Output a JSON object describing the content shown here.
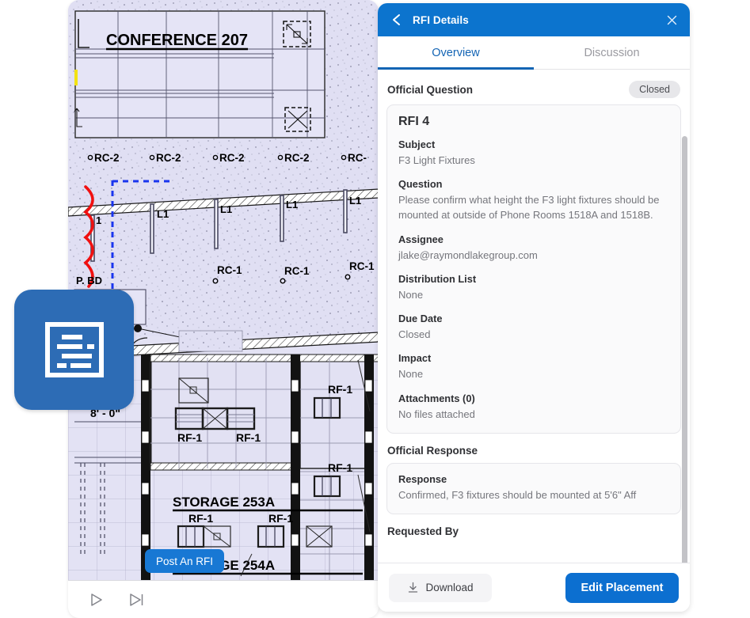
{
  "plan": {
    "labels": {
      "conference_room": "CONFERENCE  207",
      "storage_253a": "STORAGE  253A",
      "storage_254a": "STORAGE  254A",
      "dimension": "8' - 0\"",
      "partial_tag": "P. BD",
      "rc2": "RC-2",
      "rc1": "RC-1",
      "rc_partial": "RC-",
      "l1": "L1",
      "rf1": "RF-1"
    },
    "post_rfi_label": "Post An RFI",
    "marker_icon": "document-lines-icon",
    "marker_color": "#2d6cb5",
    "toolbar": {
      "play_icon": "play-icon",
      "next_icon": "skip-next-icon"
    }
  },
  "panel": {
    "header": {
      "title": "RFI Details",
      "back_icon": "chevron-left-icon",
      "close_icon": "close-icon",
      "background": "#0c74ce"
    },
    "tabs": [
      {
        "label": "Overview",
        "active": true
      },
      {
        "label": "Discussion",
        "active": false
      }
    ],
    "official_question": {
      "section_title": "Official Question",
      "status_badge": "Closed",
      "card_heading": "RFI 4",
      "fields": [
        {
          "label": "Subject",
          "value": "F3 Light Fixtures"
        },
        {
          "label": "Question",
          "value": "Please confirm what height the F3 light fixtures should be mounted at outside of Phone Rooms 1518A and 1518B."
        },
        {
          "label": "Assignee",
          "value": "jlake@raymondlakegroup.com"
        },
        {
          "label": "Distribution List",
          "value": "None"
        },
        {
          "label": "Due Date",
          "value": "Closed"
        },
        {
          "label": "Impact",
          "value": "None"
        },
        {
          "label": "Attachments (0)",
          "value": "No files attached"
        }
      ]
    },
    "official_response": {
      "section_title": "Official Response",
      "fields": [
        {
          "label": "Response",
          "value": "Confirmed, F3 fixtures should be mounted at 5'6\" Aff"
        }
      ]
    },
    "requested_by": {
      "section_title": "Requested By"
    },
    "footer": {
      "download_label": "Download",
      "download_icon": "download-icon",
      "edit_placement_label": "Edit Placement",
      "accent_color": "#0c6fd0"
    }
  }
}
